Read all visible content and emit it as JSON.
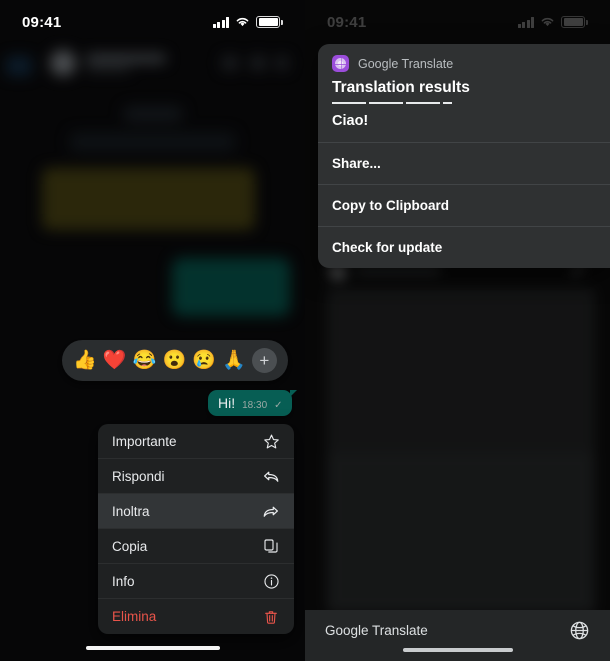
{
  "left_phone": {
    "status_bar": {
      "time": "09:41",
      "signal_icon": "cellular-signal-icon",
      "wifi_icon": "wifi-icon",
      "battery_icon": "battery-icon"
    },
    "reaction_bar": {
      "emojis": [
        {
          "name": "thumbs-up-reaction",
          "glyph": "👍"
        },
        {
          "name": "heart-reaction",
          "glyph": "❤️"
        },
        {
          "name": "joy-reaction",
          "glyph": "😂"
        },
        {
          "name": "surprised-reaction",
          "glyph": "😮"
        },
        {
          "name": "cry-reaction",
          "glyph": "😢"
        },
        {
          "name": "pray-reaction",
          "glyph": "🙏"
        }
      ],
      "plus_label": "+"
    },
    "message": {
      "text": "Hi!",
      "time": "18:30",
      "check": "✓"
    },
    "context_menu": {
      "items": [
        {
          "label": "Importante",
          "icon": "star-icon",
          "highlight": false,
          "danger": false
        },
        {
          "label": "Rispondi",
          "icon": "reply-icon",
          "highlight": false,
          "danger": false
        },
        {
          "label": "Inoltra",
          "icon": "forward-icon",
          "highlight": true,
          "danger": false
        },
        {
          "label": "Copia",
          "icon": "copy-icon",
          "highlight": false,
          "danger": false
        },
        {
          "label": "Info",
          "icon": "info-icon",
          "highlight": false,
          "danger": false
        },
        {
          "label": "Elimina",
          "icon": "trash-icon",
          "highlight": false,
          "danger": true
        }
      ]
    }
  },
  "right_phone": {
    "status_bar": {
      "time": "09:41",
      "signal_icon": "cellular-signal-icon",
      "wifi_icon": "wifi-icon",
      "battery_icon": "battery-icon"
    },
    "translate_popup": {
      "app_icon": "google-translate-icon",
      "app_name": "Google Translate",
      "title": "Translation results",
      "result": "Ciao!",
      "actions": [
        {
          "label": "Share..."
        },
        {
          "label": "Copy to Clipboard"
        },
        {
          "label": "Check for update"
        }
      ]
    },
    "bottom_bar": {
      "label": "Google Translate",
      "globe_icon": "globe-icon"
    }
  },
  "colors": {
    "bubble_green": "#075e54",
    "popup_bg": "#2f3132",
    "menu_bg": "#1f2122",
    "danger": "#e8544a",
    "translate_purple": "#9b4ddb"
  }
}
